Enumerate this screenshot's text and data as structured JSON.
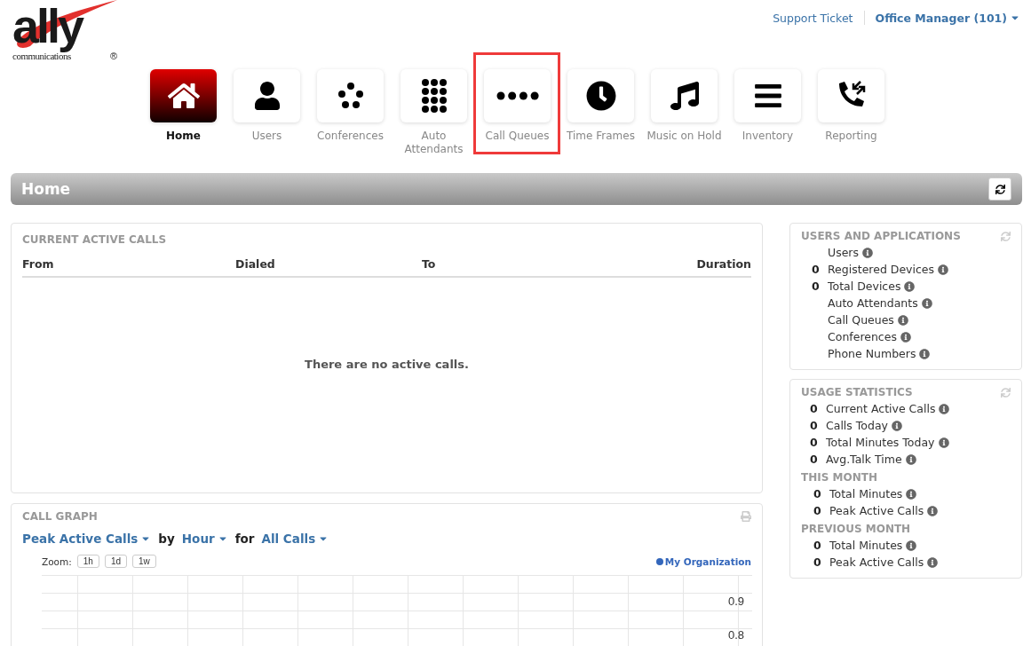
{
  "logo": {
    "wordmark": "ally",
    "tagline": "communications",
    "mark": "®"
  },
  "top_links": {
    "support": "Support Ticket",
    "account": "Office Manager (101)"
  },
  "nav": [
    {
      "label": "Home",
      "selected": true,
      "highlighted": false
    },
    {
      "label": "Users",
      "selected": false,
      "highlighted": false
    },
    {
      "label": "Conferences",
      "selected": false,
      "highlighted": false
    },
    {
      "label": "Auto Attendants",
      "selected": false,
      "highlighted": false
    },
    {
      "label": "Call Queues",
      "selected": false,
      "highlighted": true
    },
    {
      "label": "Time Frames",
      "selected": false,
      "highlighted": false
    },
    {
      "label": "Music on Hold",
      "selected": false,
      "highlighted": false
    },
    {
      "label": "Inventory",
      "selected": false,
      "highlighted": false
    },
    {
      "label": "Reporting",
      "selected": false,
      "highlighted": false
    }
  ],
  "page_title": "Home",
  "active_calls": {
    "title": "CURRENT ACTIVE CALLS",
    "columns": [
      "From",
      "Dialed",
      "To",
      "Duration"
    ],
    "empty_message": "There are no active calls."
  },
  "call_graph": {
    "title": "CALL GRAPH",
    "metric": "Peak Active Calls",
    "by_label": "by",
    "interval": "Hour",
    "for_label": "for",
    "filter": "All Calls",
    "zoom_label": "Zoom:",
    "zoom_buttons": [
      "1h",
      "1d",
      "1w"
    ],
    "legend": "My Organization",
    "y_labels": [
      "0.9",
      "0.8"
    ]
  },
  "users_and_applications": {
    "title": "USERS AND APPLICATIONS",
    "rows": [
      {
        "label": "Users"
      },
      {
        "count": "0",
        "label": "Registered Devices"
      },
      {
        "count": "0",
        "label": "Total Devices"
      },
      {
        "label": "Auto Attendants"
      },
      {
        "label": "Call Queues"
      },
      {
        "label": "Conferences"
      },
      {
        "label": "Phone Numbers"
      }
    ]
  },
  "usage_statistics": {
    "title": "USAGE STATISTICS",
    "sections": [
      {
        "rows": [
          {
            "count": "0",
            "label": "Current Active Calls"
          },
          {
            "count": "0",
            "label": "Calls Today"
          },
          {
            "count": "0",
            "label": "Total Minutes Today"
          },
          {
            "count": "0",
            "label": "Avg.Talk Time"
          }
        ]
      },
      {
        "heading": "THIS MONTH",
        "rows": [
          {
            "count": "0",
            "label": "Total Minutes"
          },
          {
            "count": "0",
            "label": "Peak Active Calls"
          }
        ]
      },
      {
        "heading": "PREVIOUS MONTH",
        "rows": [
          {
            "count": "0",
            "label": "Total Minutes"
          },
          {
            "count": "0",
            "label": "Peak Active Calls"
          }
        ]
      }
    ]
  }
}
